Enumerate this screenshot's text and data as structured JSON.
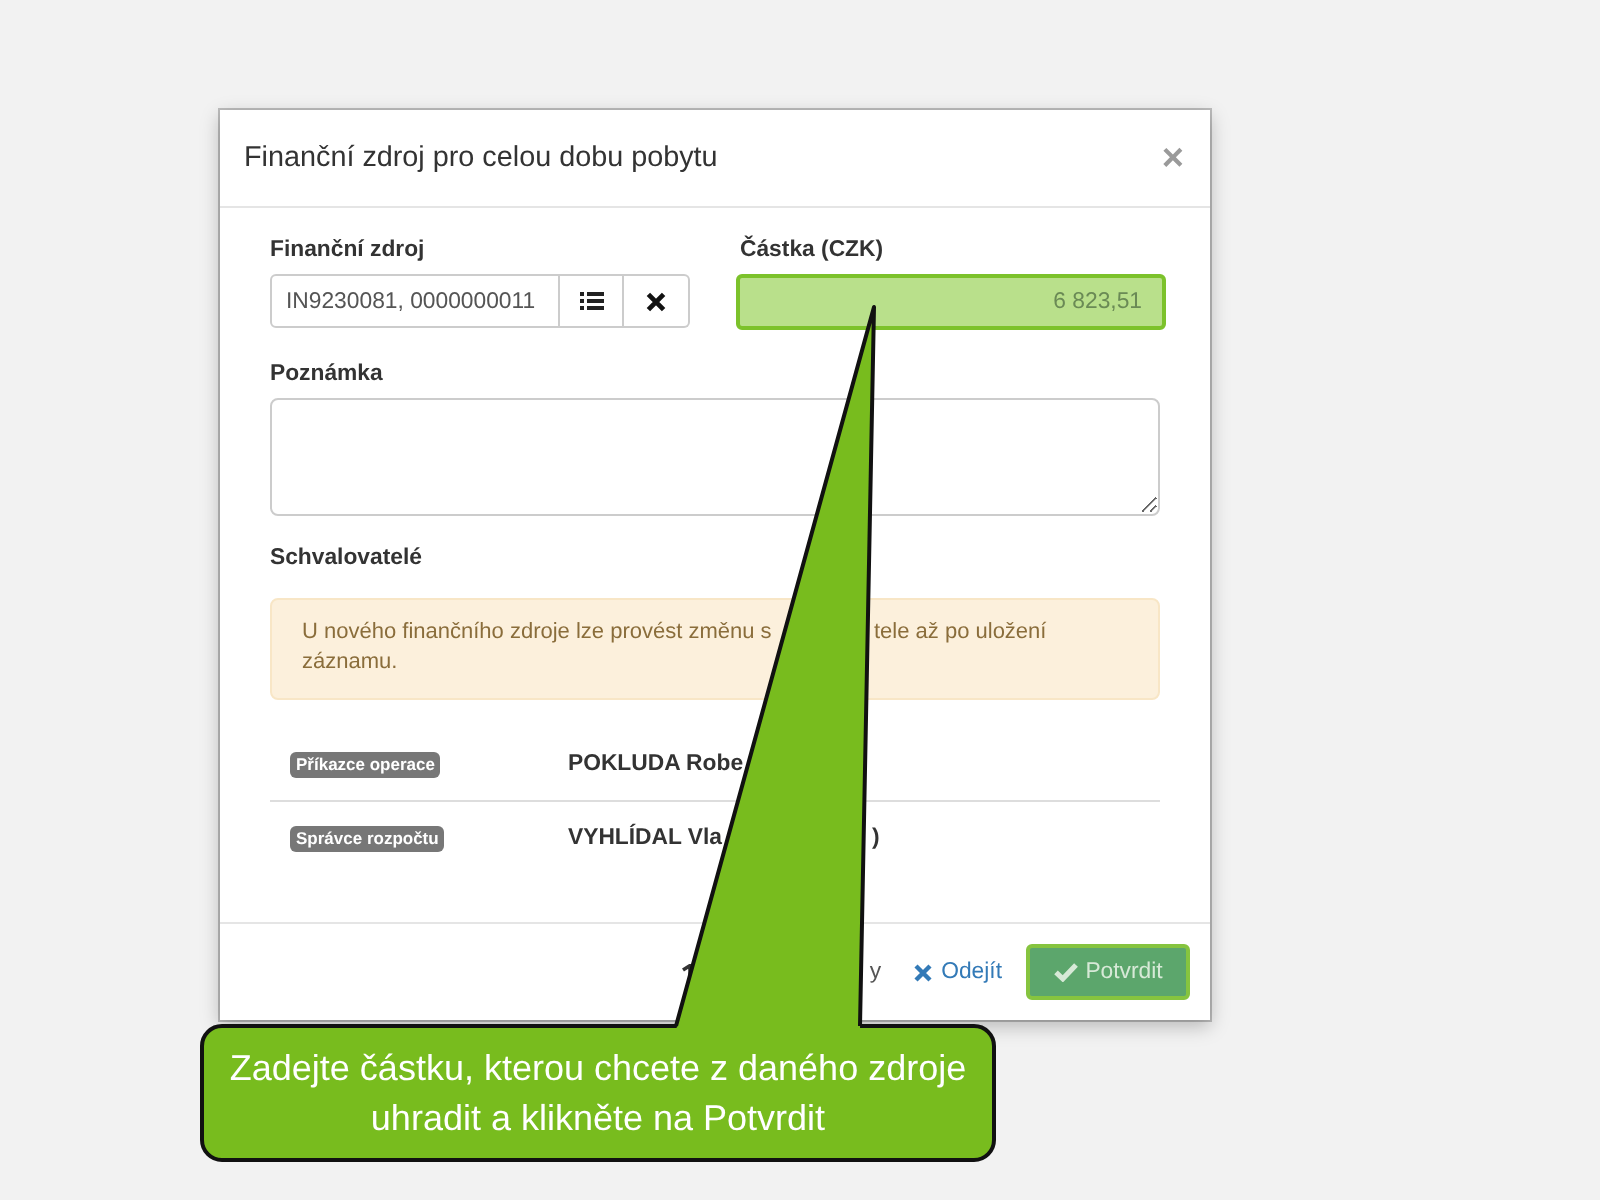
{
  "dialog": {
    "title": "Finanční zdroj pro celou dobu pobytu",
    "close_label": "×"
  },
  "source_field": {
    "label": "Finanční zdroj",
    "value": "IN9230081, 0000000011"
  },
  "amount_field": {
    "label": "Částka (CZK)",
    "value": "6 823,51",
    "highlighted": true
  },
  "note_field": {
    "label": "Poznámka"
  },
  "approvers": {
    "heading": "Schvalovatelé",
    "notice_lines": [
      [
        "U nového finančního zdroje lze provést změnu s",
        "tele až po uložení"
      ],
      [
        "záznamu."
      ]
    ],
    "rows": [
      {
        "role": "Příkazce operace",
        "name_parts": [
          "POKLUDA Robe"
        ]
      },
      {
        "role": "Správce rozpočtu",
        "name_parts": [
          "VYHLÍDAL Vla",
          ")"
        ]
      }
    ]
  },
  "footer": {
    "buttons": [
      {
        "kind": "plain",
        "label": "y"
      },
      {
        "kind": "link",
        "label": "Odejít"
      },
      {
        "kind": "primary",
        "label": "Potvrdit",
        "highlighted": true
      }
    ]
  },
  "callout": {
    "text": "Zadejte částku, kterou chcete z daného zdroje uhradit a klikněte na Potvrdit"
  }
}
